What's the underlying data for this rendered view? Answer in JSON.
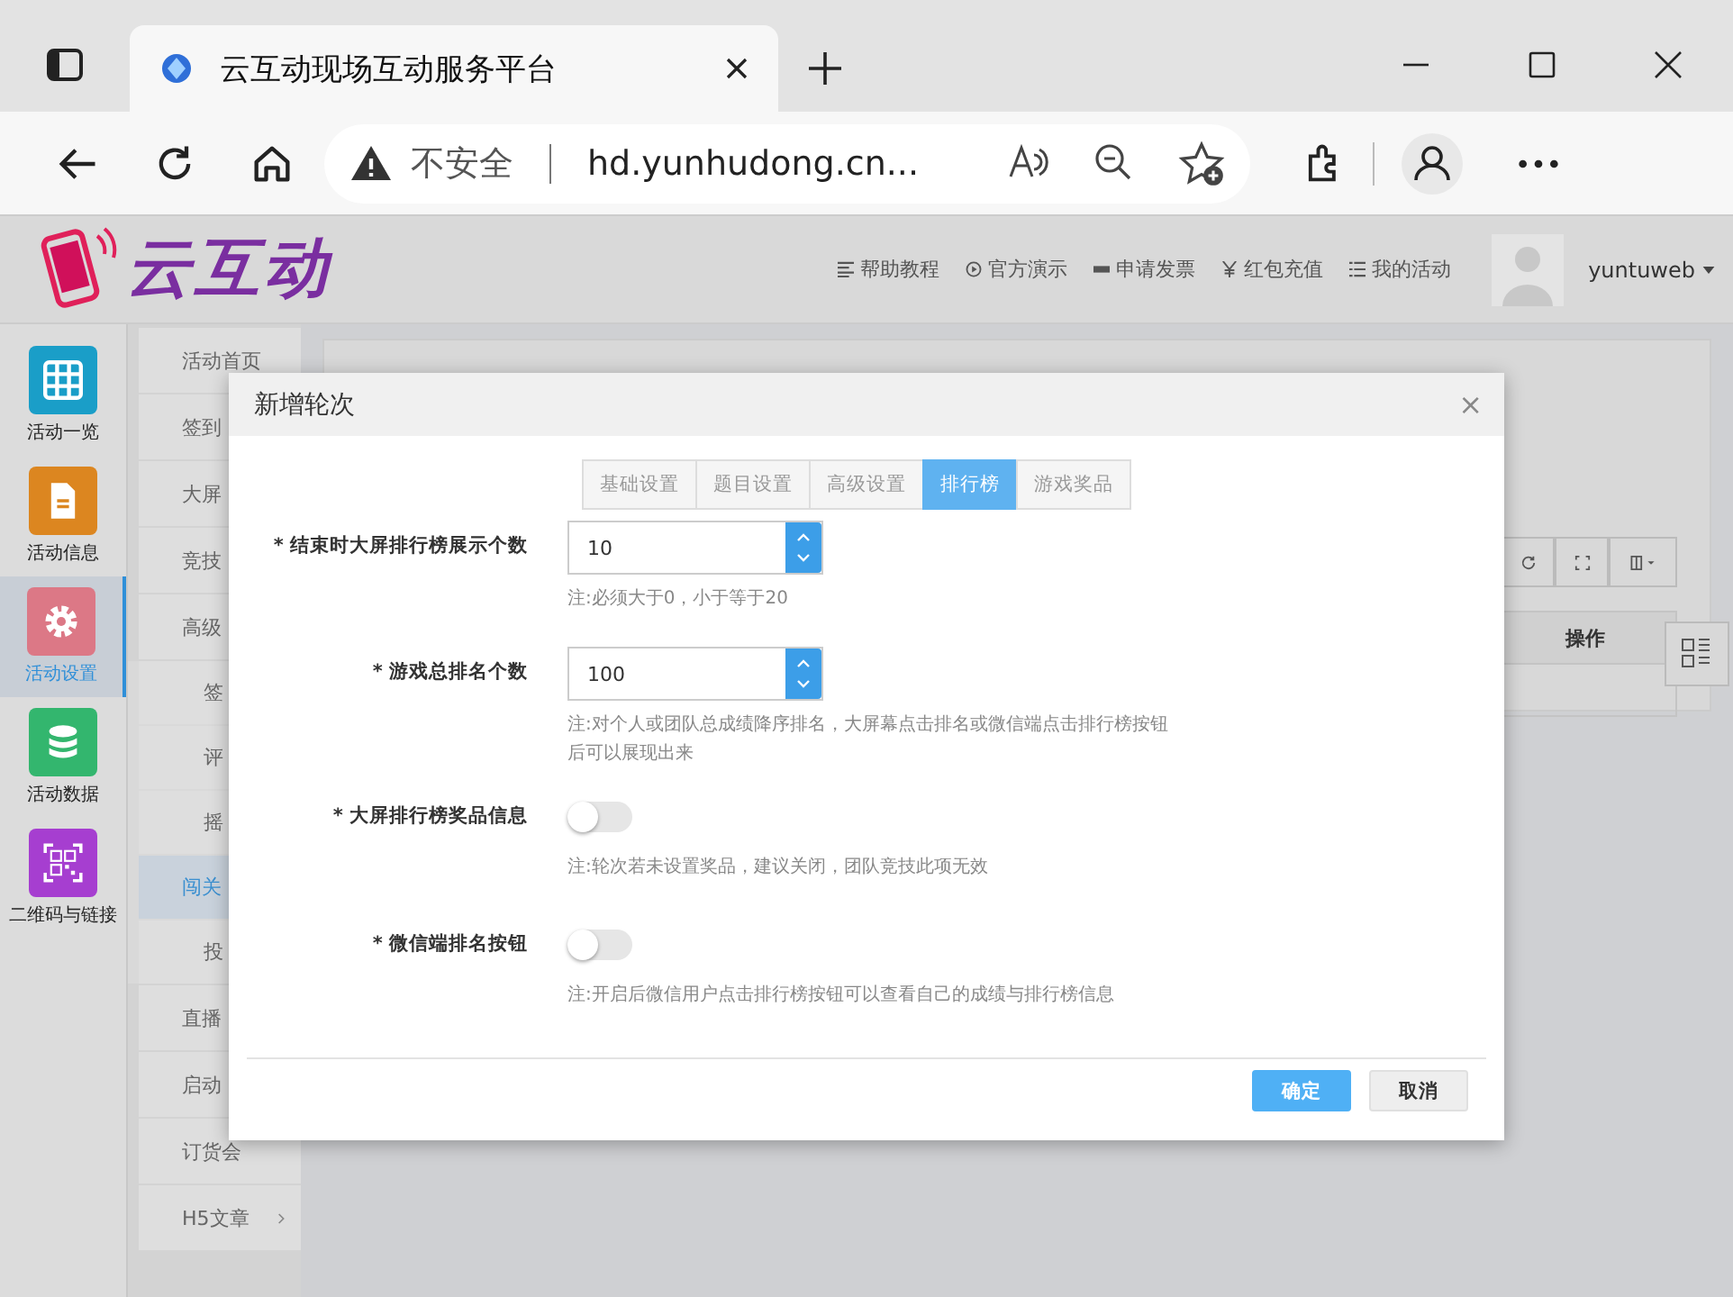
{
  "browser": {
    "tab_title": "云互动现场互动服务平台",
    "security": "不安全",
    "url": "hd.yunhudong.cn..."
  },
  "header": {
    "logo": "云互动",
    "nav": [
      {
        "label": "帮助教程"
      },
      {
        "label": "官方演示"
      },
      {
        "label": "申请发票"
      },
      {
        "label": "红包充值"
      },
      {
        "label": "我的活动"
      }
    ],
    "user": "yuntuweb"
  },
  "sidebar": {
    "items": [
      {
        "label": "活动一览",
        "color": "#1a9ec8",
        "selected": false
      },
      {
        "label": "活动信息",
        "color": "#dc8620",
        "selected": false
      },
      {
        "label": "活动设置",
        "color": "#dc7886",
        "selected": true
      },
      {
        "label": "活动数据",
        "color": "#33b66e",
        "selected": false
      },
      {
        "label": "二维码与链接",
        "color": "#a63ed0",
        "selected": false
      }
    ]
  },
  "submenu": [
    {
      "label": "活动首页",
      "selected": false
    },
    {
      "label": "签到",
      "selected": false
    },
    {
      "label": "大屏",
      "selected": false
    },
    {
      "label": "竞技",
      "selected": false
    },
    {
      "label": "高级",
      "selected": false,
      "children": [
        {
          "label": "签",
          "selected": false
        },
        {
          "label": "评",
          "selected": false
        },
        {
          "label": "摇",
          "selected": false
        },
        {
          "label": "闯关",
          "selected": true
        },
        {
          "label": "投",
          "selected": false
        }
      ]
    },
    {
      "label": "直播",
      "selected": false
    },
    {
      "label": "启动",
      "selected": false
    },
    {
      "label": "订货会",
      "selected": false
    },
    {
      "label": "H5文章",
      "selected": false,
      "expandable": true
    }
  ],
  "table": {
    "columns": [
      "操作"
    ]
  },
  "modal": {
    "title": "新增轮次",
    "close": "×",
    "tabs": [
      {
        "label": "基础设置",
        "selected": false
      },
      {
        "label": "题目设置",
        "selected": false
      },
      {
        "label": "高级设置",
        "selected": false
      },
      {
        "label": "排行榜",
        "selected": true
      },
      {
        "label": "游戏奖品",
        "selected": false
      }
    ],
    "fields": [
      {
        "kind": "number",
        "label": "* 结束时大屏排行榜展示个数",
        "value": "10",
        "note": "注:必须大于0，小于等于20"
      },
      {
        "kind": "number",
        "label": "* 游戏总排名个数",
        "value": "100",
        "note": "注:对个人或团队总成绩降序排名，大屏幕点击排名或微信端点击排行榜按钮后可以展现出来"
      },
      {
        "kind": "toggle",
        "label": "* 大屏排行榜奖品信息",
        "on": false,
        "note": "注:轮次若未设置奖品，建议关闭，团队竞技此项无效"
      },
      {
        "kind": "toggle",
        "label": "* 微信端排名按钮",
        "on": false,
        "note": "注:开启后微信用户点击排行榜按钮可以查看自己的成绩与排行榜信息"
      }
    ],
    "buttons": [
      {
        "label": "确定",
        "kind": "primary"
      },
      {
        "label": "取消",
        "kind": "default"
      }
    ]
  }
}
